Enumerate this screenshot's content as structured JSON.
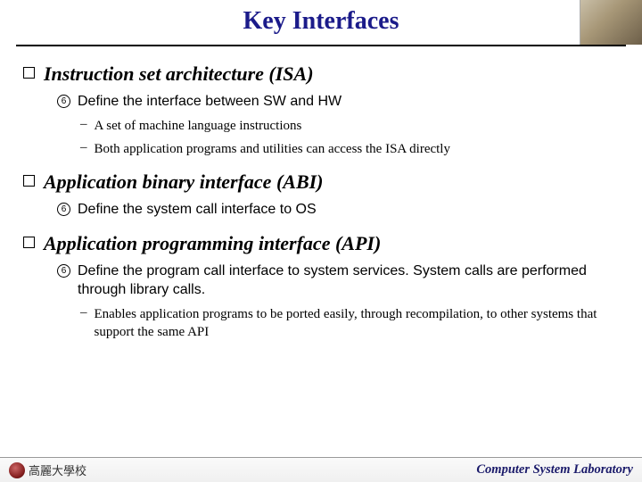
{
  "title": "Key Interfaces",
  "sections": [
    {
      "heading": "Instruction set architecture (ISA)",
      "subs": [
        {
          "num": "6",
          "text": "Define the interface between SW and HW",
          "dashes": [
            "A set of machine language instructions",
            "Both application programs and utilities can access the ISA directly"
          ]
        }
      ]
    },
    {
      "heading": "Application binary interface (ABI)",
      "subs": [
        {
          "num": "6",
          "text": "Define the system call interface to OS",
          "dashes": []
        }
      ]
    },
    {
      "heading": "Application programming interface (API)",
      "subs": [
        {
          "num": "6",
          "text": "Define the program call interface to system services. System calls are performed through library calls.",
          "dashes": [
            "Enables application programs to be ported easily, through recompilation, to other systems that support the same API"
          ]
        }
      ]
    }
  ],
  "footer": {
    "left": "高麗大學校",
    "right": "Computer System Laboratory"
  }
}
